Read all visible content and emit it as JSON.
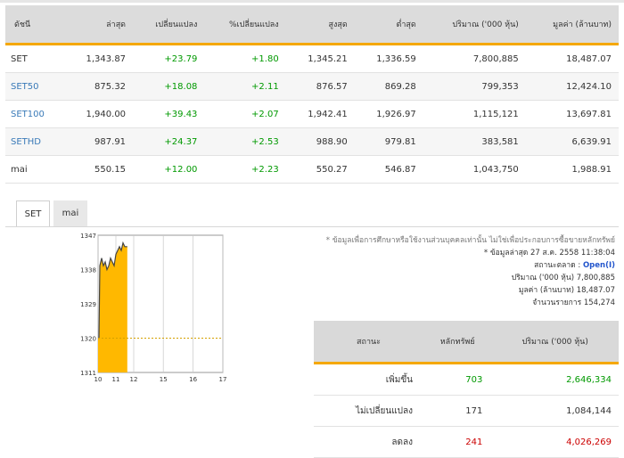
{
  "table": {
    "headers": [
      "ดัชนี",
      "ล่าสุด",
      "เปลี่ยนแปลง",
      "%เปลี่ยนแปลง",
      "สูงสุด",
      "ต่ำสุด",
      "ปริมาณ ('000 หุ้น)",
      "มูลค่า (ล้านบาท)"
    ],
    "rows": [
      {
        "name": "SET",
        "last": "1,343.87",
        "chg": "+23.79",
        "pct": "+1.80",
        "high": "1,345.21",
        "low": "1,336.59",
        "vol": "7,800,885",
        "val": "18,487.07"
      },
      {
        "name": "SET50",
        "last": "875.32",
        "chg": "+18.08",
        "pct": "+2.11",
        "high": "876.57",
        "low": "869.28",
        "vol": "799,353",
        "val": "12,424.10"
      },
      {
        "name": "SET100",
        "last": "1,940.00",
        "chg": "+39.43",
        "pct": "+2.07",
        "high": "1,942.41",
        "low": "1,926.97",
        "vol": "1,115,121",
        "val": "13,697.81"
      },
      {
        "name": "SETHD",
        "last": "987.91",
        "chg": "+24.37",
        "pct": "+2.53",
        "high": "988.90",
        "low": "979.81",
        "vol": "383,581",
        "val": "6,639.91"
      },
      {
        "name": "mai",
        "last": "550.15",
        "chg": "+12.00",
        "pct": "+2.23",
        "high": "550.27",
        "low": "546.87",
        "vol": "1,043,750",
        "val": "1,988.91"
      }
    ]
  },
  "tabs": [
    "SET",
    "mai"
  ],
  "info": {
    "note": "* ข้อมูลเพื่อการศึกษาหรือใช้งานส่วนบุคคลเท่านั้น ไม่ใช่เพื่อประกอบการซื้อขายหลักทรัพย์",
    "updated": "* ข้อมูลล่าสุด 27 ส.ค. 2558 11:38:04",
    "status_label": "สถานะตลาด :",
    "status_value": "Open(I)",
    "volume_label": "ปริมาณ ('000 หุ้น)",
    "volume_value": "7,800,885",
    "value_label": "มูลค่า (ล้านบาท)",
    "value_value": "18,487.07",
    "deals_label": "จำนวนรายการ",
    "deals_value": "154,274"
  },
  "summary": {
    "headers": [
      "สถานะ",
      "หลักทรัพย์",
      "ปริมาณ ('000 หุ้น)"
    ],
    "rows": [
      {
        "status": "เพิ่มขึ้น",
        "count": "703",
        "vol": "2,646,334"
      },
      {
        "status": "ไม่เปลี่ยนแปลง",
        "count": "171",
        "vol": "1,084,144"
      },
      {
        "status": "ลดลง",
        "count": "241",
        "vol": "4,026,269"
      }
    ]
  },
  "colors": {
    "up": "#009900",
    "down": "#cc0000",
    "accent": "#f5a800",
    "link": "#3a7ab8"
  },
  "chart_data": {
    "type": "area",
    "y_ticks": [
      "1347",
      "1338",
      "1329",
      "1320",
      "1311"
    ],
    "x_ticks": [
      "10",
      "11",
      "12",
      "15",
      "16",
      "17"
    ],
    "ylim": [
      1311,
      1347
    ],
    "xlim": [
      10,
      17
    ],
    "x_tick_positions": [
      10,
      11,
      12,
      13.66,
      15.33,
      17
    ],
    "baseline": 1320,
    "x": [
      10.0,
      10.05,
      10.1,
      10.2,
      10.3,
      10.4,
      10.5,
      10.6,
      10.7,
      10.8,
      10.9,
      11.0,
      11.1,
      11.2,
      11.3,
      11.4,
      11.5,
      11.64
    ],
    "y": [
      1320,
      1320,
      1339,
      1341,
      1339,
      1340,
      1338,
      1339,
      1341,
      1340,
      1339,
      1342,
      1343,
      1344,
      1343,
      1345,
      1344,
      1344
    ]
  }
}
